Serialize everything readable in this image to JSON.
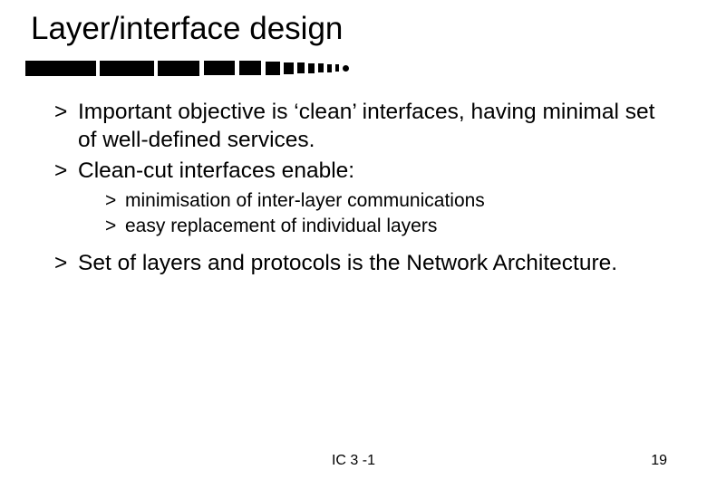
{
  "title": "Layer/interface design",
  "bullets": {
    "b1": "Important objective is ‘clean’ interfaces, having minimal set of well-defined services.",
    "b2": "Clean-cut interfaces enable:",
    "b2_sub": {
      "s1": "minimisation of inter-layer communications",
      "s2": "easy replacement of individual layers"
    },
    "b3": "Set of layers and protocols is the Network Architecture."
  },
  "footer": {
    "code": "IC 3 -1",
    "page": "19"
  }
}
